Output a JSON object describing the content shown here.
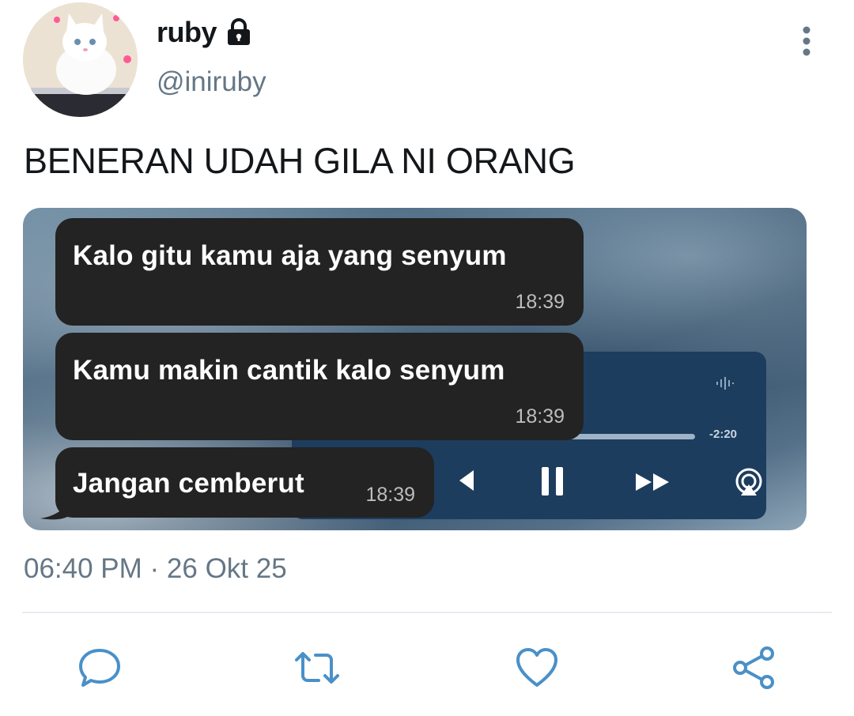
{
  "author": {
    "display_name": "ruby",
    "handle": "@iniruby",
    "avatar_icon": "cat-avatar",
    "protected_icon": "lock-icon"
  },
  "tweet": {
    "text": "BENERAN UDAH GILA NI ORANG",
    "timestamp": "06:40 PM · 26 Okt 25"
  },
  "media": {
    "messages": [
      {
        "text": "Kalo gitu kamu aja yang senyum",
        "time": "18:39"
      },
      {
        "text": "Kamu makin cantik kalo senyum",
        "time": "18:39"
      },
      {
        "text": "Jangan cemberut",
        "time": "18:39"
      }
    ],
    "player": {
      "time_remaining": "-2:20",
      "controls": [
        "rewind-icon",
        "pause-icon",
        "fast-forward-icon",
        "airplay-icon"
      ]
    }
  },
  "actions": [
    "reply-icon",
    "retweet-icon",
    "like-icon",
    "share-icon"
  ],
  "colors": {
    "text_primary": "#14171a",
    "text_secondary": "#657786",
    "icon": "#4a90c8",
    "bubble": "#232323"
  }
}
